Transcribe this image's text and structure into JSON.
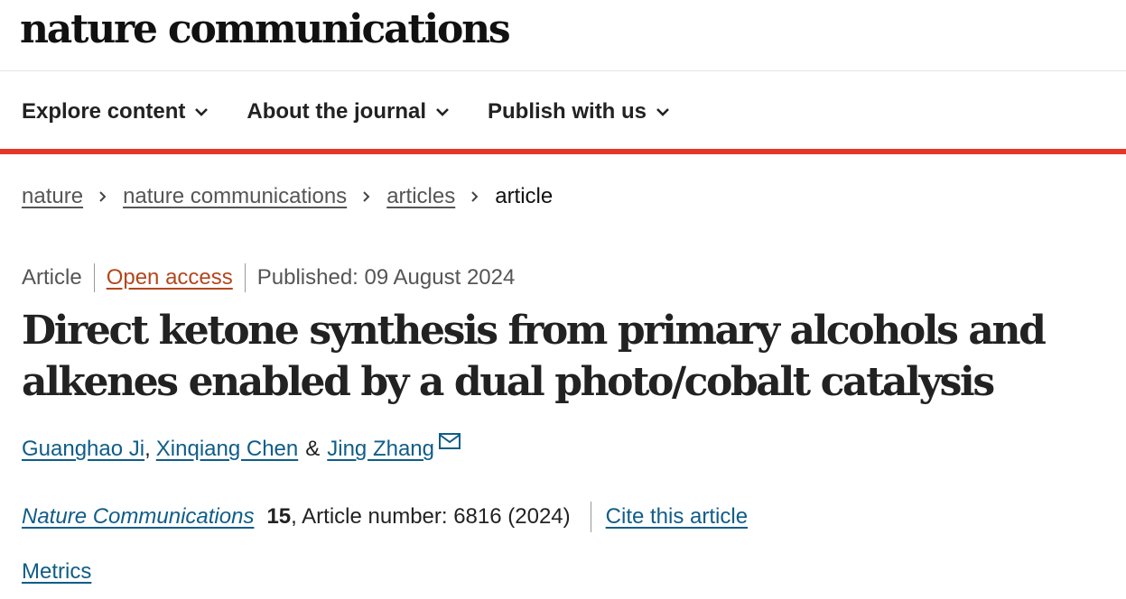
{
  "header": {
    "logo_text": "nature communications"
  },
  "nav": {
    "items": [
      {
        "label": "Explore content",
        "icon": "chevron-down-icon"
      },
      {
        "label": "About the journal",
        "icon": "chevron-down-icon"
      },
      {
        "label": "Publish with us",
        "icon": "chevron-down-icon"
      }
    ],
    "accent_color": "#e5362a"
  },
  "breadcrumb": {
    "items": [
      "nature",
      "nature communications",
      "articles",
      "article"
    ],
    "separator_icon": "chevron-right-icon"
  },
  "article": {
    "type": "Article",
    "access": "Open access",
    "published": "Published: 09 August 2024",
    "title": "Direct ketone synthesis from primary alcohols and alkenes enabled by a dual photo/cobalt catalysis",
    "authors": [
      {
        "name": "Guanghao Ji"
      },
      {
        "name": "Xinqiang Chen"
      },
      {
        "name": "Jing Zhang",
        "icon": "mail-icon"
      }
    ],
    "author_sep_comma": ",",
    "author_sep_amp": "&",
    "journal": "Nature Communications",
    "volume": "15",
    "article_number": ", Article number: 6816 (2024)",
    "cite_label": "Cite this article",
    "metrics_label": "Metrics"
  },
  "colors": {
    "link": "#0f5d89",
    "open_access": "#b3471c",
    "text": "#222222"
  }
}
